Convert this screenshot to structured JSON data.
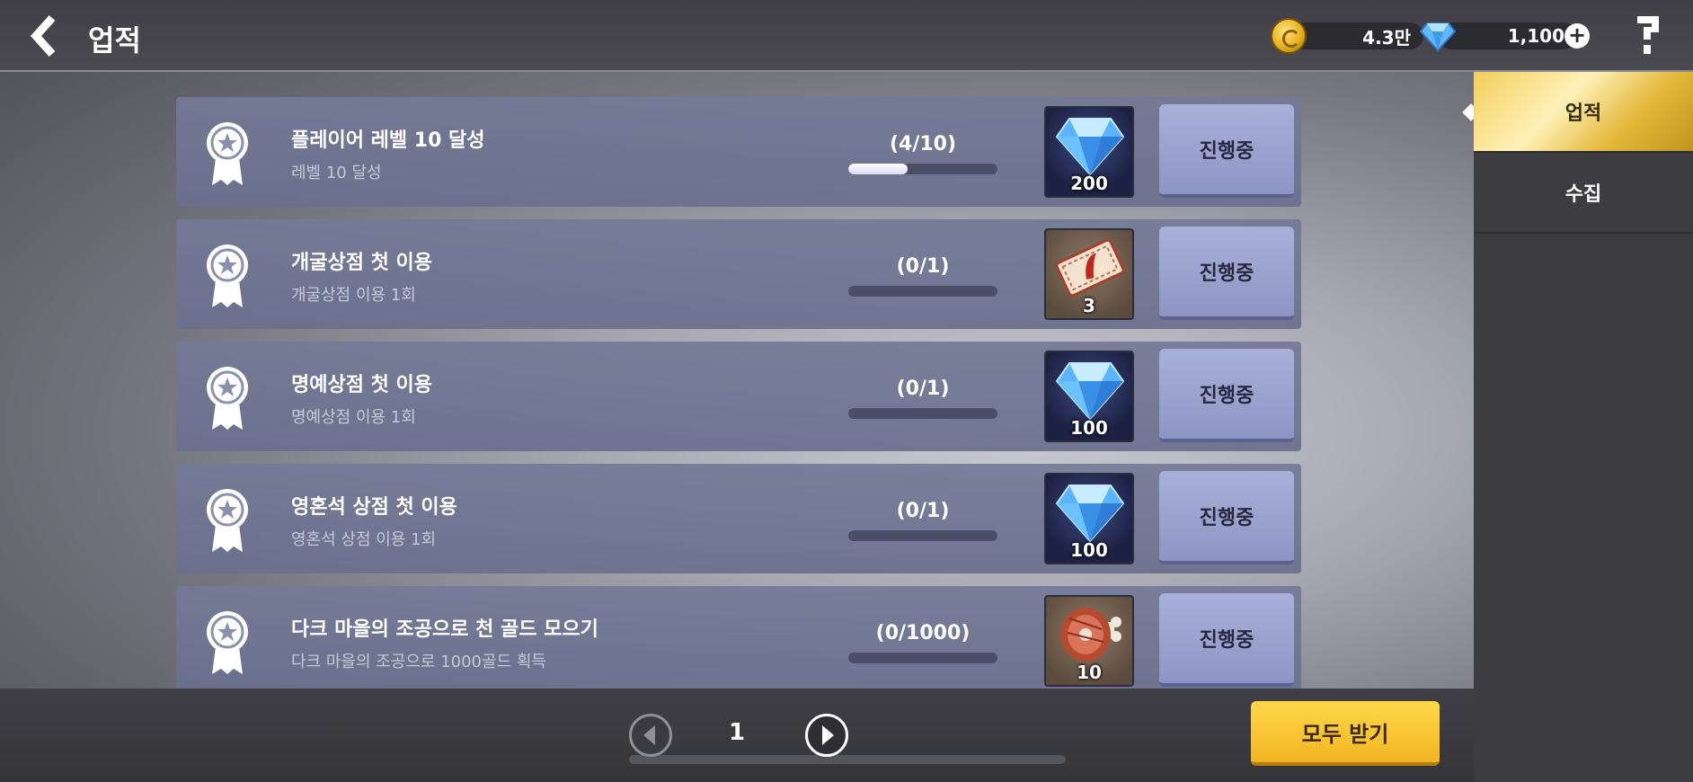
{
  "header": {
    "title": "업적",
    "gold": "4.3만",
    "gems": "1,100"
  },
  "sidebar": {
    "tabs": [
      {
        "label": "업적",
        "active": true
      },
      {
        "label": "수집",
        "active": false
      }
    ]
  },
  "achievements": [
    {
      "title": "플레이어 레벨 10 달성",
      "desc": "레벨 10 달성",
      "progress": "(4/10)",
      "fraction": 0.4,
      "reward_icon": "gem-icon",
      "reward_count": "200",
      "status": "진행중"
    },
    {
      "title": "개굴상점 첫 이용",
      "desc": "개굴상점 이용 1회",
      "progress": "(0/1)",
      "fraction": 0,
      "reward_icon": "ticket-icon",
      "reward_count": "3",
      "status": "진행중"
    },
    {
      "title": "명예상점 첫 이용",
      "desc": "명예상점 이용 1회",
      "progress": "(0/1)",
      "fraction": 0,
      "reward_icon": "gem-icon",
      "reward_count": "100",
      "status": "진행중"
    },
    {
      "title": "영혼석 상점 첫 이용",
      "desc": "영혼석 상점 이용 1회",
      "progress": "(0/1)",
      "fraction": 0,
      "reward_icon": "gem-icon",
      "reward_count": "100",
      "status": "진행중"
    },
    {
      "title": "다크 마을의 조공으로 천 골드 모으기",
      "desc": "다크 마을의 조공으로 1000골드 획득",
      "progress": "(0/1000)",
      "fraction": 0,
      "reward_icon": "meat-icon",
      "reward_count": "10",
      "status": "진행중"
    }
  ],
  "pagination": {
    "page": "1"
  },
  "footer": {
    "claim_all": "모두 받기"
  },
  "colors": {
    "accent": "#f1b522",
    "row_bg": "#747a96",
    "button": "#a9b0d8"
  }
}
